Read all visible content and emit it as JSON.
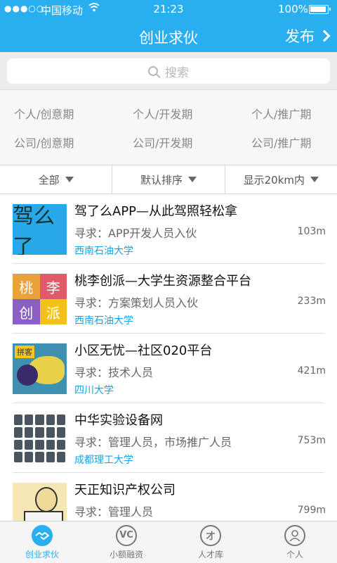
{
  "status_bar": {
    "signal": "●●●○○",
    "carrier": "中国移动",
    "time": "21:23",
    "battery": "100%"
  },
  "nav": {
    "title": "创业求伙",
    "publish": "发布"
  },
  "search": {
    "placeholder": "搜索"
  },
  "categories": [
    "个人/创意期",
    "个人/开发期",
    "个人/推广期",
    "公司/创意期",
    "公司/开发期",
    "公司/推广期"
  ],
  "filters": {
    "all": "全部",
    "sort": "默认排序",
    "range": "显示20km内"
  },
  "projects": [
    {
      "title": "驾了么APP—从此驾照轻松拿",
      "seek": "寻求：APP开发人员入伙",
      "school": "西南石油大学",
      "distance": "103m",
      "thumb_text": "驾么了"
    },
    {
      "title": "桃李创派—大学生资源整合平台",
      "seek": "寻求：方案策划人员入伙",
      "school": "西南石油大学",
      "distance": "233m",
      "thumb_chars": [
        "桃",
        "李",
        "创",
        "派"
      ]
    },
    {
      "title": "小区无忧—社区020平台",
      "seek": "寻求：技术人员",
      "school": "四川大学",
      "distance": "421m",
      "thumb_text": "拼客"
    },
    {
      "title": "中华实验设备网",
      "seek": "寻求：管理人员，市场推广人员",
      "school": "成都理工大学",
      "distance": "753m"
    },
    {
      "title": "天正知识产权公司",
      "seek": "寻求：管理人员",
      "school": "",
      "distance": "799m"
    }
  ],
  "tabs": [
    {
      "label": "创业求伙",
      "icon": "handshake-icon",
      "active": true
    },
    {
      "label": "小额融资",
      "icon": "vc-icon",
      "icon_text": "VC"
    },
    {
      "label": "人才库",
      "icon": "talent-icon",
      "icon_text": "才"
    },
    {
      "label": "个人",
      "icon": "person-icon"
    }
  ],
  "colors": {
    "primary": "#29aef0",
    "school_link": "#1ba3e3"
  }
}
